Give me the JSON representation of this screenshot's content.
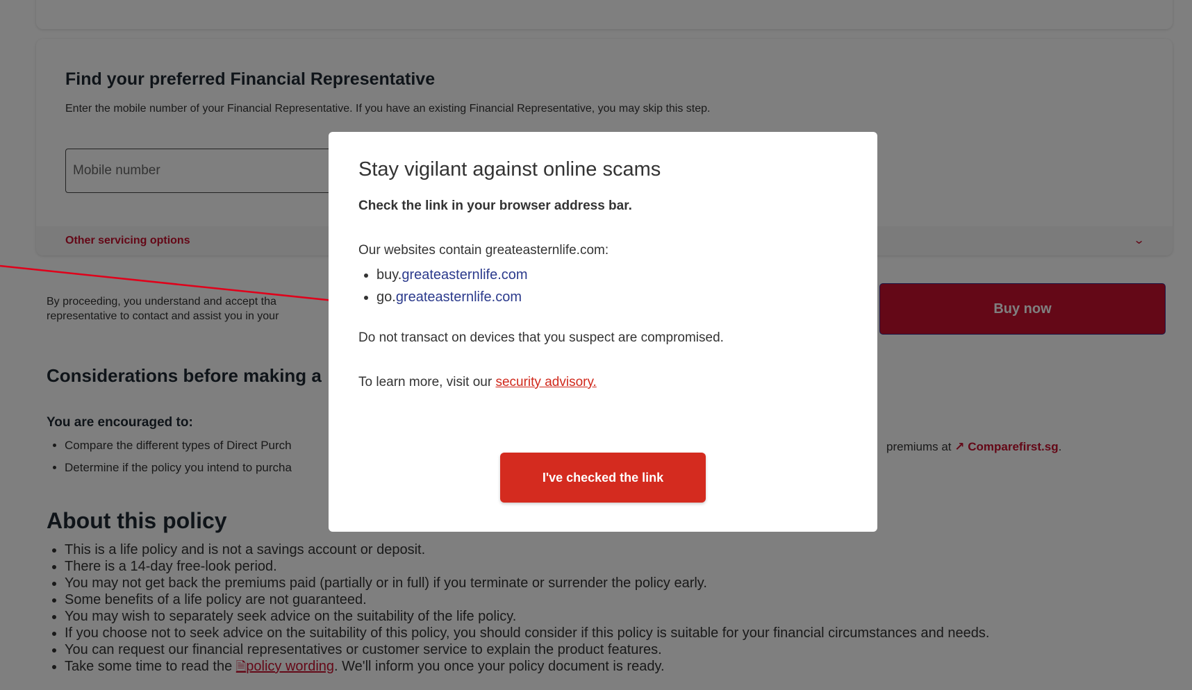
{
  "financial_rep": {
    "title": "Find your preferred Financial Representative",
    "description": "Enter the mobile number of your Financial Representative. If you have an existing Financial Representative, you may skip this step.",
    "mobile_placeholder": "Mobile number",
    "other_servicing_label": "Other servicing options"
  },
  "proceed": {
    "line1": "By proceeding, you understand and accept tha",
    "line2": "representative to contact and assist you in your",
    "buy_now_label": "Buy now"
  },
  "considerations": {
    "title": "Considerations before making a",
    "encouraged_title": "You are encouraged to:",
    "items": [
      "Compare the different types of Direct Purch",
      "Determine if the policy you intend to purcha"
    ],
    "comparefirst_prefix": "premiums at",
    "comparefirst_link": "Comparefirst.sg",
    "comparefirst_suffix": "."
  },
  "about": {
    "title": "About this policy",
    "items": [
      "This is a life policy and is not a savings account or deposit.",
      "There is a 14-day free-look period.",
      "You may not get back the premiums paid (partially or in full) if you terminate or surrender the policy early.",
      "Some benefits of a life policy are not guaranteed.",
      "You may wish to separately seek advice on the suitability of the life policy.",
      "If you choose not to seek advice on the suitability of this policy, you should consider if this policy is suitable for your financial circumstances and needs.",
      "You can request our financial representatives or customer service to explain the product features."
    ],
    "last_prefix": "Take some time to read the",
    "last_link": "policy wording",
    "last_suffix": ". We'll inform you once your policy document is ready."
  },
  "modal": {
    "title": "Stay vigilant against online scams",
    "subtitle": "Check the link in your browser address bar.",
    "sites_intro": "Our websites contain greateasternlife.com:",
    "sites": [
      {
        "prefix": "buy.",
        "domain": "greateasternlife.com"
      },
      {
        "prefix": "go.",
        "domain": "greateasternlife.com"
      }
    ],
    "device_warning": "Do not transact on devices that you suspect are compromised.",
    "learn_prefix": "To learn more, visit our",
    "learn_link": "security advisory.",
    "confirm_label": "I've checked the link"
  },
  "colors": {
    "brand_red": "#c8102e",
    "link_blue": "#2b3a8c",
    "overlay": "rgba(0,0,0,0.5)",
    "annotation_arrow": "#e0001a"
  }
}
